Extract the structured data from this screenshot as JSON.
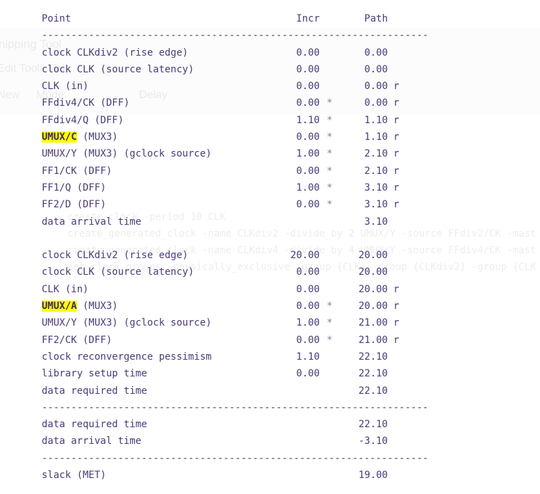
{
  "background_ghost": {
    "app_title": "nipping Tool",
    "menu": "Edit  Tools  Help",
    "toolbar": [
      "New",
      "Mode",
      "Delay"
    ],
    "code_lines": [
      "create_clock -period 10 CLK",
      "create_generated_clock -name CLKdiv2 -divide_by 2 UMUX/Y -source FFdiv2/CK -mast",
      "create_generated_clock -name CLKdiv4 -divide_by 4 UMUX/Y -source FFdiv4/CK -mast",
      "set_clock_groups -physically_exclusive -group {CLK} -group {CLKdiv2} -group {CLK"
    ]
  },
  "header": {
    "point": "Point",
    "incr": "Incr",
    "path": "Path"
  },
  "separator": "------------------------------------------------------------------",
  "rows": [
    {
      "type": "header"
    },
    {
      "type": "sep"
    },
    {
      "point": "clock CLKdiv2 (rise edge)",
      "incr": "0.00",
      "star": "",
      "path": "0.00",
      "flag": ""
    },
    {
      "point": "clock CLK (source latency)",
      "incr": "0.00",
      "star": "",
      "path": "0.00",
      "flag": ""
    },
    {
      "point": "CLK (in)",
      "incr": "0.00",
      "star": "",
      "path": "0.00",
      "flag": "r"
    },
    {
      "point": "FFdiv4/CK (DFF)",
      "incr": "0.00",
      "star": "*",
      "path": "0.00",
      "flag": "r"
    },
    {
      "point": "FFdiv4/Q (DFF)",
      "incr": "1.10",
      "star": "*",
      "path": "1.10",
      "flag": "r"
    },
    {
      "point_hl": "UMUX/C",
      "point": " (MUX3)",
      "incr": "0.00",
      "star": "*",
      "path": "1.10",
      "flag": "r"
    },
    {
      "point": "UMUX/Y (MUX3) (gclock source)",
      "incr": "1.00",
      "star": "*",
      "path": "2.10",
      "flag": "r"
    },
    {
      "point": "FF1/CK (DFF)",
      "incr": "0.00",
      "star": "*",
      "path": "2.10",
      "flag": "r"
    },
    {
      "point": "FF1/Q (DFF)",
      "incr": "1.00",
      "star": "*",
      "path": "3.10",
      "flag": "r"
    },
    {
      "point": "FF2/D (DFF)",
      "incr": "0.00",
      "star": "*",
      "path": "3.10",
      "flag": "r"
    },
    {
      "point": "data arrival time",
      "incr": "",
      "star": "",
      "path": "3.10",
      "flag": ""
    },
    {
      "type": "blank"
    },
    {
      "point": "clock CLKdiv2 (rise edge)",
      "incr": "20.00",
      "star": "",
      "path": "20.00",
      "flag": ""
    },
    {
      "point": "clock CLK (source latency)",
      "incr": "0.00",
      "star": "",
      "path": "20.00",
      "flag": ""
    },
    {
      "point": "CLK (in)",
      "incr": "0.00",
      "star": "",
      "path": "20.00",
      "flag": "r"
    },
    {
      "point_hl": "UMUX/A",
      "point": " (MUX3)",
      "incr": "0.00",
      "star": "*",
      "path": "20.00",
      "flag": "r"
    },
    {
      "point": "UMUX/Y (MUX3) (gclock source)",
      "incr": "1.00",
      "star": "*",
      "path": "21.00",
      "flag": "r"
    },
    {
      "point": "FF2/CK (DFF)",
      "incr": "0.00",
      "star": "*",
      "path": "21.00",
      "flag": "r"
    },
    {
      "point": "clock reconvergence pessimism",
      "incr": "1.10",
      "star": "",
      "path": "22.10",
      "flag": ""
    },
    {
      "point": "library setup time",
      "incr": "0.00",
      "star": "",
      "path": "22.10",
      "flag": ""
    },
    {
      "point": "data required time",
      "incr": "",
      "star": "",
      "path": "22.10",
      "flag": ""
    },
    {
      "type": "sep"
    },
    {
      "point": "data required time",
      "incr": "",
      "star": "",
      "path": "22.10",
      "flag": ""
    },
    {
      "point": "data arrival time",
      "incr": "",
      "star": "",
      "path": "-3.10",
      "flag": ""
    },
    {
      "type": "sep"
    },
    {
      "point": "slack (MET)",
      "incr": "",
      "star": "",
      "path": "19.00",
      "flag": ""
    }
  ],
  "colors": {
    "text": "#4b3a78",
    "highlight": "#ffff00"
  }
}
